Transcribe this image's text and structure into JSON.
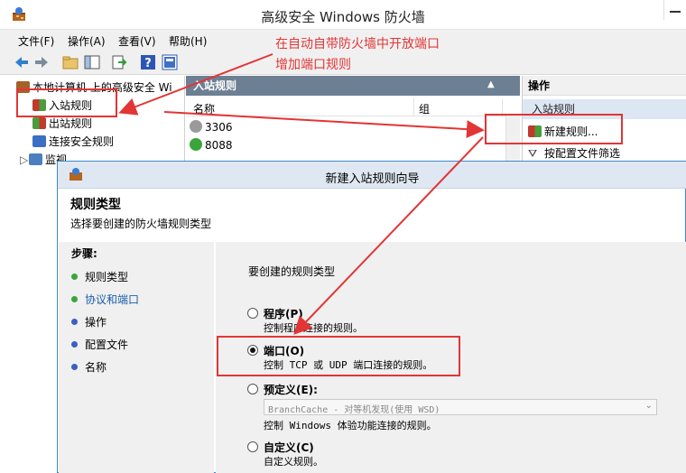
{
  "window": {
    "title": "高级安全 Windows 防火墙"
  },
  "menu": [
    "文件(F)",
    "操作(A)",
    "查看(V)",
    "帮助(H)"
  ],
  "annotation": {
    "line1": "在自动自带防火墙中开放端口",
    "line2": "增加端口规则",
    "color": "#e23535"
  },
  "tree": {
    "root": "本地计算机 上的高级安全 Wi",
    "inbound": "入站规则",
    "outbound": "出站规则",
    "connection": "连接安全规则",
    "monitor": "监视"
  },
  "inbound_list": {
    "header": "入站规则",
    "col_name": "名称",
    "col_group": "组",
    "rows": [
      "3306",
      "8088"
    ]
  },
  "actions": {
    "header": "操作",
    "section": "入站规则",
    "new_rule": "新建规则...",
    "filter_profile": "按配置文件筛选"
  },
  "wizard": {
    "title": "新建入站规则向导",
    "heading": "规则类型",
    "subheading": "选择要创建的防火墙规则类型",
    "steps_label": "步骤:",
    "steps": [
      "规则类型",
      "协议和端口",
      "操作",
      "配置文件",
      "名称"
    ],
    "prompt": "要创建的规则类型",
    "options": [
      {
        "label": "程序(P)",
        "desc": "控制程序连接的规则。",
        "selected": false
      },
      {
        "label": "端口(O)",
        "desc": "控制 TCP 或 UDP 端口连接的规则。",
        "selected": true
      },
      {
        "label": "预定义(E):",
        "desc": "控制 Windows 体验功能连接的规则。",
        "selected": false
      },
      {
        "label": "自定义(C)",
        "desc": "自定义规则。",
        "selected": false
      }
    ],
    "predefined_value": "BranchCache - 对等机发现(使用 WSD)"
  }
}
